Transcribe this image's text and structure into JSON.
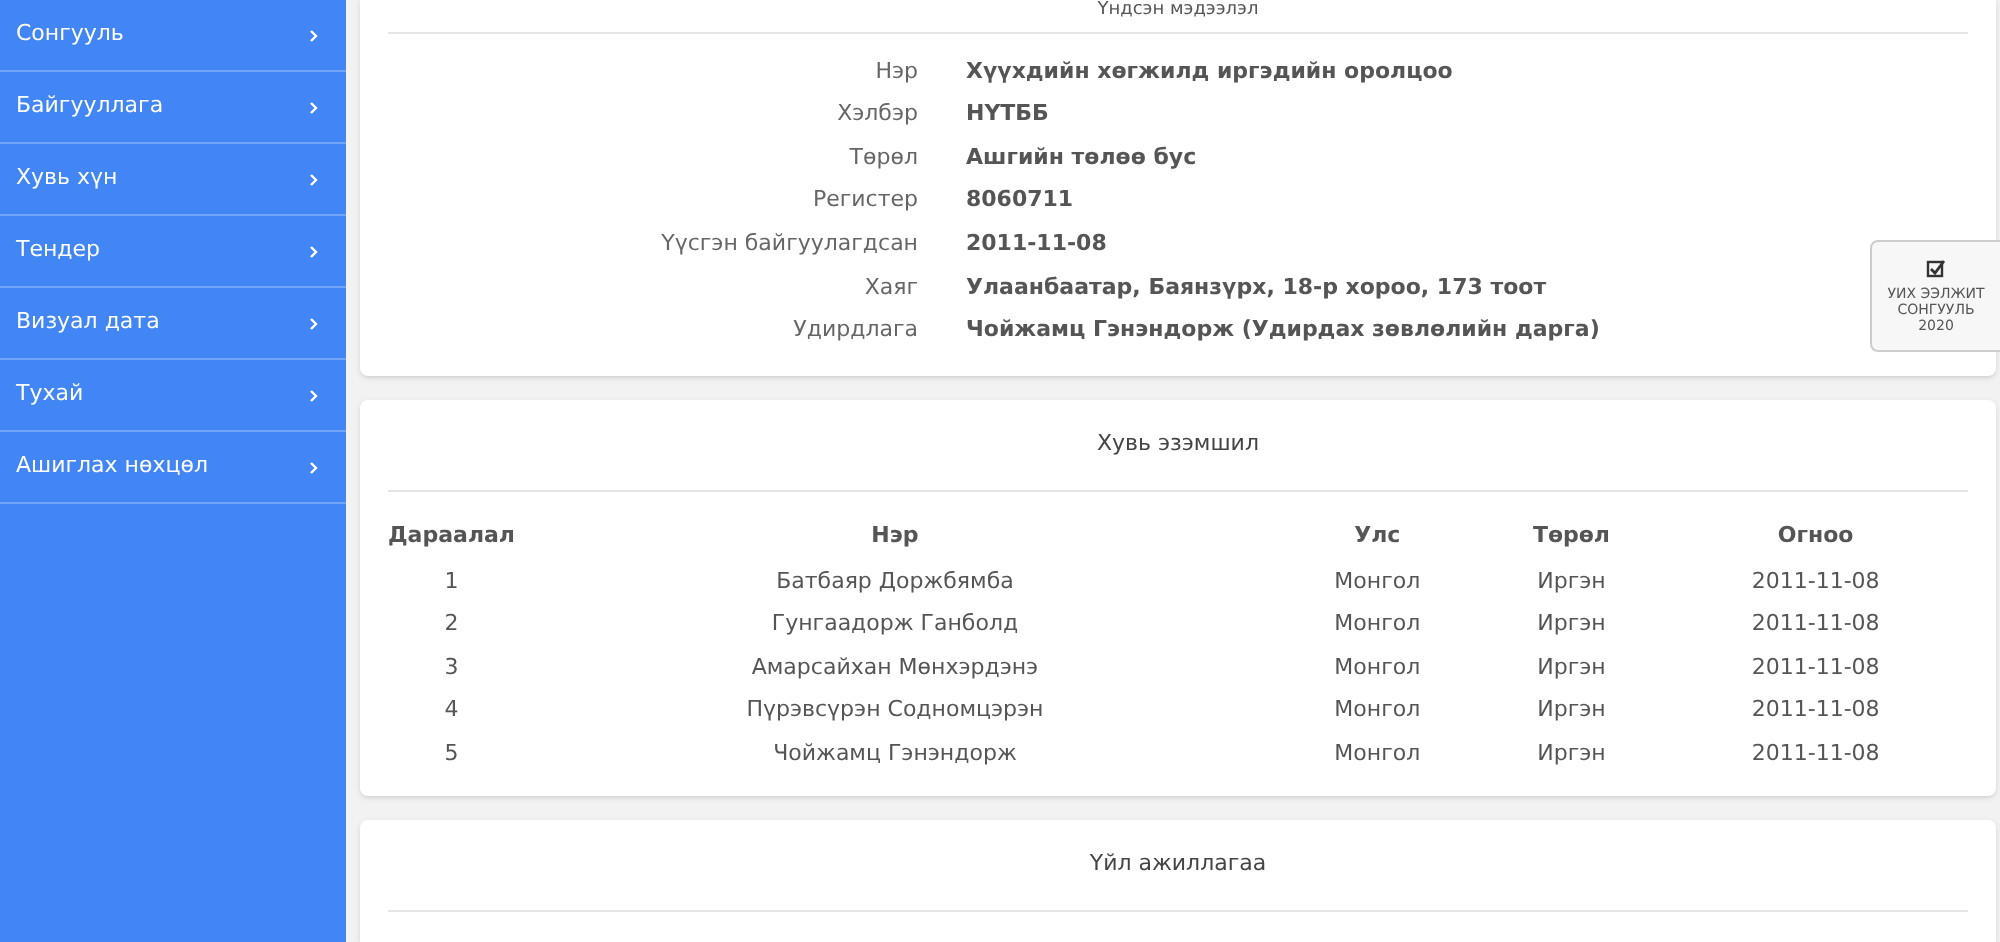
{
  "sidebar": {
    "items": [
      {
        "label": "Сонгууль"
      },
      {
        "label": "Байгууллага"
      },
      {
        "label": "Хувь хүн"
      },
      {
        "label": "Тендер"
      },
      {
        "label": "Визуал дата"
      },
      {
        "label": "Тухай"
      },
      {
        "label": "Ашиглах нөхцөл"
      }
    ]
  },
  "info_card": {
    "title": "Үндсэн мэдээлэл",
    "fields": [
      {
        "label": "Нэр",
        "value": "Хүүхдийн хөгжилд иргэдийн оролцоо"
      },
      {
        "label": "Хэлбэр",
        "value": "НҮТББ"
      },
      {
        "label": "Төрөл",
        "value": "Ашгийн төлөө бус"
      },
      {
        "label": "Регистер",
        "value": "8060711"
      },
      {
        "label": "Үүсгэн байгуулагдсан",
        "value": "2011-11-08"
      },
      {
        "label": "Хаяг",
        "value": "Улаанбаатар, Баянзүрх, 18-р хороо, 173 тоот"
      },
      {
        "label": "Удирдлага",
        "value": "Чойжамц Гэнэндорж (Удирдах зөвлөлийн дарга)"
      }
    ]
  },
  "ownership_card": {
    "title": "Хувь эзэмшил",
    "columns": [
      "Дараалал",
      "Нэр",
      "Улс",
      "Төрөл",
      "Огноо"
    ],
    "rows": [
      [
        "1",
        "Батбаяр Доржбямба",
        "Монгол",
        "Иргэн",
        "2011-11-08"
      ],
      [
        "2",
        "Гунгаадорж Ганболд",
        "Монгол",
        "Иргэн",
        "2011-11-08"
      ],
      [
        "3",
        "Амарсайхан Мөнхэрдэнэ",
        "Монгол",
        "Иргэн",
        "2011-11-08"
      ],
      [
        "4",
        "Пүрэвсүрэн Содномцэрэн",
        "Монгол",
        "Иргэн",
        "2011-11-08"
      ],
      [
        "5",
        "Чойжамц Гэнэндорж",
        "Монгол",
        "Иргэн",
        "2011-11-08"
      ]
    ]
  },
  "activity_card": {
    "title": "Үйл ажиллагаа"
  },
  "floating_button": {
    "lines": [
      "УИХ ЭЭЛЖИТ",
      "СОНГУУЛЬ",
      "2020"
    ]
  }
}
